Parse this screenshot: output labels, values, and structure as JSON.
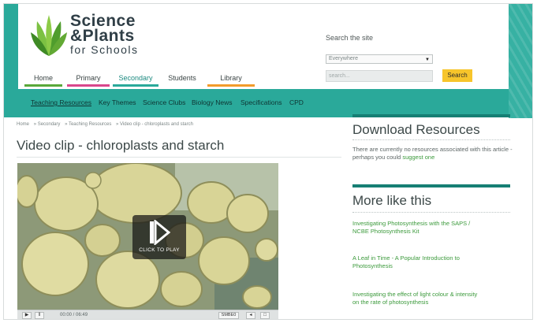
{
  "brand": {
    "line1": "Science",
    "line2": "&Plants",
    "line3": "for Schools",
    "colors": {
      "teal": "#2aa99a",
      "dark_teal": "#167f74",
      "leaf_green": "#5aa83a",
      "search_yellow": "#f7c52b"
    }
  },
  "search": {
    "title": "Search the site",
    "scope_value": "Everywhere",
    "placeholder": "search...",
    "button_label": "Search"
  },
  "main_nav": [
    {
      "label": "Home",
      "color": "#5aa83a",
      "active": false
    },
    {
      "label": "Primary",
      "color": "#d9478c",
      "active": false
    },
    {
      "label": "Secondary",
      "color": "#2aa99a",
      "active": true
    },
    {
      "label": "Students",
      "color": "#ffffff",
      "active": false
    },
    {
      "label": "Library",
      "color": "#f29b2b",
      "active": false
    }
  ],
  "sub_nav": [
    {
      "label": "Teaching Resources",
      "active": true
    },
    {
      "label": "Key Themes",
      "active": false
    },
    {
      "label": "Science Clubs",
      "active": false
    },
    {
      "label": "Biology News",
      "active": false
    },
    {
      "label": "Specifications",
      "active": false
    },
    {
      "label": "CPD",
      "active": false
    }
  ],
  "breadcrumb": [
    "Home",
    "» Secondary",
    "» Teaching Resources",
    "» Video clip - chloroplasts and starch"
  ],
  "page_title": "Video clip - chloroplasts and starch",
  "video": {
    "overlay_label": "CLICK TO PLAY",
    "timecode": "00:00 / 06:49",
    "quality_label": "SMBE0",
    "play_icon": "play-icon",
    "pause_icon": "pause-icon"
  },
  "download": {
    "title": "Download Resources",
    "text": "There are currently no resources associated with this article - perhaps you could",
    "link": "suggest one"
  },
  "more": {
    "title": "More like this",
    "items": [
      "Investigating Photosynthesis with the SAPS / NCBE Photosynthesis Kit",
      "A Leaf in Time - A Popular Introduction to Photosynthesis",
      "Investigating the effect of light colour & intensity on the rate of photosynthesis"
    ]
  }
}
